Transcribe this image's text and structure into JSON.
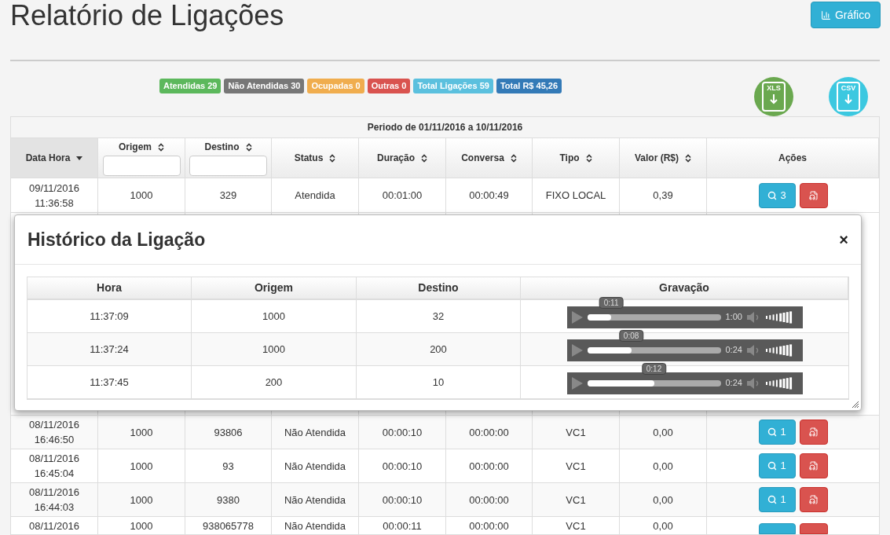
{
  "page": {
    "title": "Relatório de Ligações",
    "chart_button": "Gráfico"
  },
  "summary_badges": [
    {
      "label": "Atendidas 29",
      "color": "#5cb85c"
    },
    {
      "label": "Não Atendidas 30",
      "color": "#777777"
    },
    {
      "label": "Ocupadas 0",
      "color": "#f0ad4e"
    },
    {
      "label": "Outras 0",
      "color": "#d9534f"
    },
    {
      "label": "Total Ligações 59",
      "color": "#5bc0de"
    },
    {
      "label": "Total R$ 45,26",
      "color": "#337ab7"
    }
  ],
  "exports": [
    {
      "label": "XLS",
      "color": "#6aa84f"
    },
    {
      "label": "CSV",
      "color": "#3cc8e0"
    }
  ],
  "table": {
    "period": "Periodo de 01/11/2016 a 10/11/2016",
    "columns": [
      {
        "label": "Data Hora",
        "sortable": true,
        "sorted": true,
        "filter": false
      },
      {
        "label": "Origem",
        "sortable": true,
        "sorted": false,
        "filter": true
      },
      {
        "label": "Destino",
        "sortable": true,
        "sorted": false,
        "filter": true
      },
      {
        "label": "Status",
        "sortable": true,
        "sorted": false,
        "filter": false
      },
      {
        "label": "Duração",
        "sortable": true,
        "sorted": false,
        "filter": false
      },
      {
        "label": "Conversa",
        "sortable": true,
        "sorted": false,
        "filter": false
      },
      {
        "label": "Tipo",
        "sortable": true,
        "sorted": false,
        "filter": false
      },
      {
        "label": "Valor (R$)",
        "sortable": true,
        "sorted": false,
        "filter": false
      },
      {
        "label": "Ações",
        "sortable": false,
        "sorted": false,
        "filter": false
      }
    ],
    "rows": [
      {
        "date": "09/11/2016",
        "time": "11:36:58",
        "origem": "1000",
        "destino": "329",
        "status": "Atendida",
        "duracao": "00:01:00",
        "conversa": "00:00:49",
        "tipo": "FIXO LOCAL",
        "valor": "0,39",
        "history_count": "3"
      },
      {
        "date": "08/11/2016",
        "time": "16:46:50",
        "origem": "1000",
        "destino": "93806",
        "status": "Não Atendida",
        "duracao": "00:00:10",
        "conversa": "00:00:00",
        "tipo": "VC1",
        "valor": "0,00",
        "history_count": "1"
      },
      {
        "date": "08/11/2016",
        "time": "16:45:04",
        "origem": "1000",
        "destino": "93",
        "status": "Não Atendida",
        "duracao": "00:00:10",
        "conversa": "00:00:00",
        "tipo": "VC1",
        "valor": "0,00",
        "history_count": "1"
      },
      {
        "date": "08/11/2016",
        "time": "16:44:03",
        "origem": "1000",
        "destino": "9380",
        "status": "Não Atendida",
        "duracao": "00:00:10",
        "conversa": "00:00:00",
        "tipo": "VC1",
        "valor": "0,00",
        "history_count": "1"
      },
      {
        "date": "08/11/2016",
        "origem": "1000",
        "destino": "938065778",
        "status": "Não Atendida",
        "duracao": "00:00:11",
        "conversa": "00:00:00",
        "tipo": "VC1",
        "valor": "0,00"
      }
    ]
  },
  "modal": {
    "title": "Histórico da Ligação",
    "close": "×",
    "columns": [
      "Hora",
      "Origem",
      "Destino",
      "Gravação"
    ],
    "rows": [
      {
        "hora": "11:37:09",
        "origem": "1000",
        "destino": "32",
        "position": "0:11",
        "duration": "1:00",
        "level": 0.18
      },
      {
        "hora": "11:37:24",
        "origem": "1000",
        "destino": "200",
        "position": "0:08",
        "duration": "0:24",
        "level": 0.33
      },
      {
        "hora": "11:37:45",
        "origem": "200",
        "destino": "10",
        "position": "0:12",
        "duration": "0:24",
        "level": 0.5
      }
    ]
  }
}
